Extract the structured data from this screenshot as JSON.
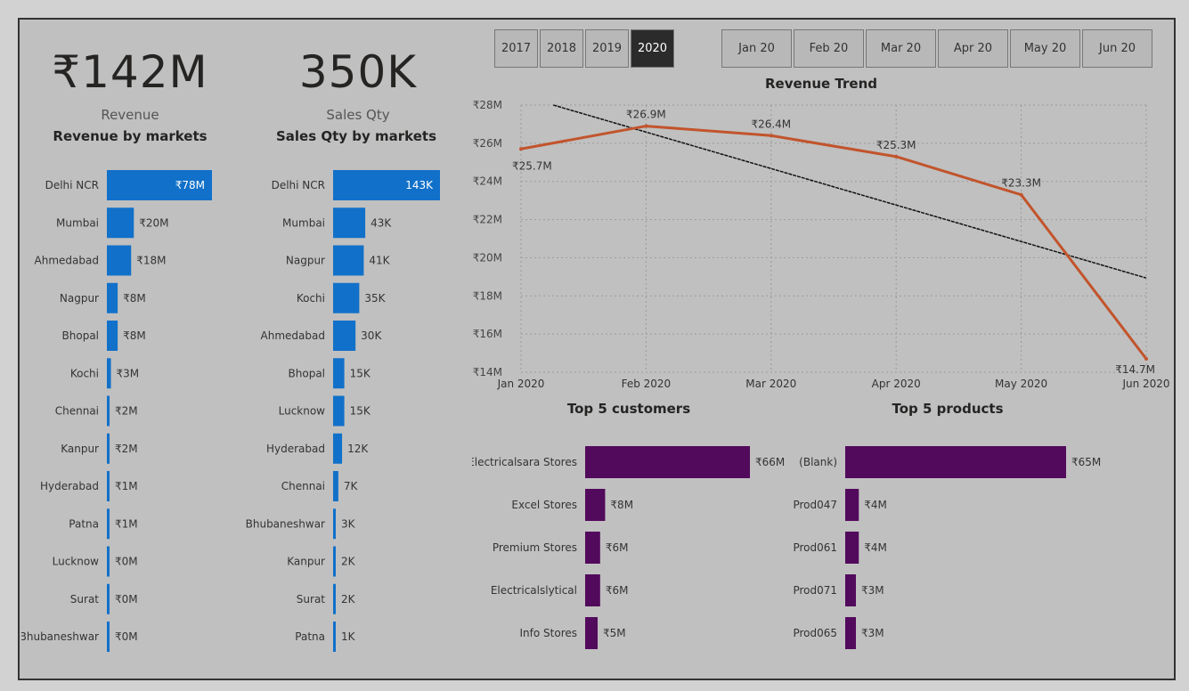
{
  "kpis": {
    "revenue": {
      "value": "₹142M",
      "label": "Revenue"
    },
    "sales_qty": {
      "value": "350K",
      "label": "Sales Qty"
    }
  },
  "slicers": {
    "years": [
      {
        "label": "2017",
        "selected": false
      },
      {
        "label": "2018",
        "selected": false
      },
      {
        "label": "2019",
        "selected": false
      },
      {
        "label": "2020",
        "selected": true
      }
    ],
    "months": [
      {
        "label": "Jan 20"
      },
      {
        "label": "Feb 20"
      },
      {
        "label": "Mar 20"
      },
      {
        "label": "Apr 20"
      },
      {
        "label": "May 20"
      },
      {
        "label": "Jun 20"
      }
    ]
  },
  "titles": {
    "revenue_by_markets": "Revenue by markets",
    "sales_qty_by_markets": "Sales Qty by markets",
    "revenue_trend": "Revenue Trend",
    "top_customers": "Top 5 customers",
    "top_products": "Top 5 products"
  },
  "colors": {
    "bar_blue": "#1170c9",
    "bar_purple": "#520a5c",
    "trend_line": "#c2542c",
    "trendline_dashed": "#111111"
  },
  "chart_data": [
    {
      "id": "revenue_by_markets",
      "type": "bar",
      "orientation": "horizontal",
      "categories": [
        "Delhi NCR",
        "Mumbai",
        "Ahmedabad",
        "Nagpur",
        "Bhopal",
        "Kochi",
        "Chennai",
        "Kanpur",
        "Hyderabad",
        "Patna",
        "Lucknow",
        "Surat",
        "Bhubaneshwar"
      ],
      "values": [
        78,
        20,
        18,
        8,
        8,
        3,
        2,
        2,
        1,
        1,
        0,
        0,
        0
      ],
      "labels": [
        "₹78M",
        "₹20M",
        "₹18M",
        "₹8M",
        "₹8M",
        "₹3M",
        "₹2M",
        "₹2M",
        "₹1M",
        "₹1M",
        "₹0M",
        "₹0M",
        "₹0M"
      ]
    },
    {
      "id": "sales_qty_by_markets",
      "type": "bar",
      "orientation": "horizontal",
      "categories": [
        "Delhi NCR",
        "Mumbai",
        "Nagpur",
        "Kochi",
        "Ahmedabad",
        "Bhopal",
        "Lucknow",
        "Hyderabad",
        "Chennai",
        "Bhubaneshwar",
        "Kanpur",
        "Surat",
        "Patna"
      ],
      "values": [
        143,
        43,
        41,
        35,
        30,
        15,
        15,
        12,
        7,
        3,
        2,
        2,
        1
      ],
      "labels": [
        "143K",
        "43K",
        "41K",
        "35K",
        "30K",
        "15K",
        "15K",
        "12K",
        "7K",
        "3K",
        "2K",
        "2K",
        "1K"
      ]
    },
    {
      "id": "revenue_trend",
      "type": "line",
      "x": [
        "Jan 2020",
        "Feb 2020",
        "Mar 2020",
        "Apr 2020",
        "May 2020",
        "Jun 2020"
      ],
      "values": [
        25.7,
        26.9,
        26.4,
        25.3,
        23.3,
        14.7
      ],
      "labels": [
        "₹25.7M",
        "₹26.9M",
        "₹26.4M",
        "₹25.3M",
        "₹23.3M",
        "₹14.7M"
      ],
      "ylim": [
        14,
        28
      ],
      "yticks": [
        "₹14M",
        "₹16M",
        "₹18M",
        "₹20M",
        "₹22M",
        "₹24M",
        "₹26M",
        "₹28M"
      ],
      "trendline": true,
      "grid": true
    },
    {
      "id": "top_customers",
      "type": "bar",
      "orientation": "horizontal",
      "categories": [
        "Electricalsara Stores",
        "Excel Stores",
        "Premium Stores",
        "Electricalslytical",
        "Info Stores"
      ],
      "values": [
        66,
        8,
        6,
        6,
        5
      ],
      "labels": [
        "₹66M",
        "₹8M",
        "₹6M",
        "₹6M",
        "₹5M"
      ]
    },
    {
      "id": "top_products",
      "type": "bar",
      "orientation": "horizontal",
      "categories": [
        "(Blank)",
        "Prod047",
        "Prod061",
        "Prod071",
        "Prod065"
      ],
      "values": [
        65,
        4,
        4,
        3,
        3
      ],
      "labels": [
        "₹65M",
        "₹4M",
        "₹4M",
        "₹3M",
        "₹3M"
      ]
    }
  ]
}
